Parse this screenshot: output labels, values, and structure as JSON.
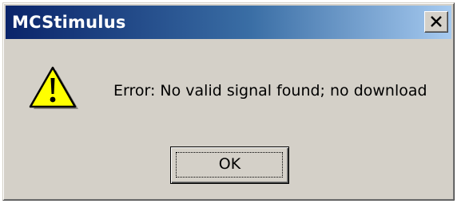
{
  "window": {
    "title": "MCStimulus",
    "close_icon": "close-x-icon"
  },
  "dialog": {
    "icon": "warning-icon",
    "message": "Error: No valid signal found; no download",
    "ok_label": "OK"
  },
  "colors": {
    "titlebar_start": "#0a246a",
    "titlebar_end": "#a6caf0",
    "dialog_face": "#d4d0c8",
    "warning_yellow": "#ffff00"
  }
}
